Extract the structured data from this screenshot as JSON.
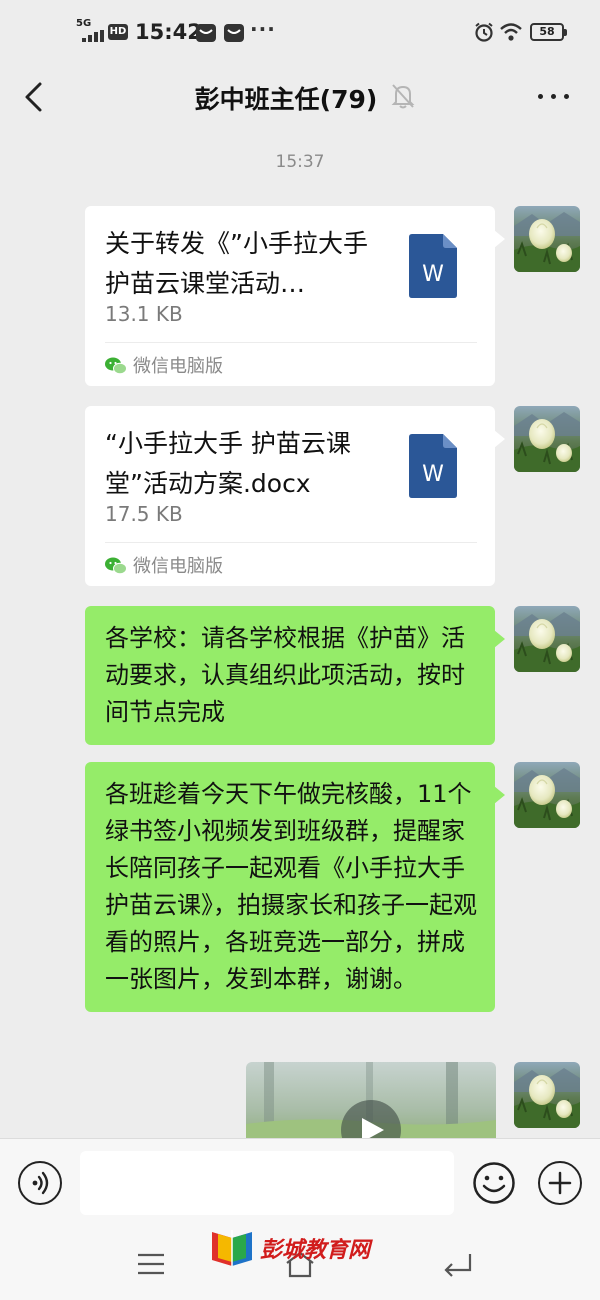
{
  "status_bar": {
    "network": "5G",
    "hd": "HD",
    "time": "15:42",
    "more": "···",
    "battery": "58"
  },
  "header": {
    "title": "彭中班主任(79)"
  },
  "chat": {
    "timestamp": "15:37",
    "messages": [
      {
        "type": "file",
        "name": "关于转发《”小手拉大手 护苗云课堂活动…",
        "size": "13.1 KB",
        "source": "微信电脑版",
        "icon_letter": "W"
      },
      {
        "type": "file",
        "name": "“小手拉大手 护苗云课堂”活动方案.docx",
        "size": "17.5 KB",
        "source": "微信电脑版",
        "icon_letter": "W"
      },
      {
        "type": "text",
        "text": "各学校：请各学校根据《护苗》活动要求，认真组织此项活动，按时间节点完成"
      },
      {
        "type": "text",
        "text": "各班趁着今天下午做完核酸，11个绿书签小视频发到班级群，提醒家长陪同孩子一起观看《小手拉大手 护苗云课》，拍摄家长和孩子一起观看的照片，各班竞选一部分，拼成一张图片，发到本群，谢谢。"
      },
      {
        "type": "video"
      }
    ]
  },
  "watermark": {
    "text": "彭城教育网"
  },
  "colors": {
    "background": "#ededed",
    "bubble_green": "#95ec69",
    "word_blue": "#2b5797",
    "watermark_red": "#d11c1c"
  },
  "icons": {
    "back": "chevron-left-icon",
    "mute": "bell-off-icon",
    "more": "ellipsis-icon",
    "voice": "voice-icon",
    "emoji": "smiley-icon",
    "plus": "plus-icon",
    "wechat": "wechat-icon"
  }
}
